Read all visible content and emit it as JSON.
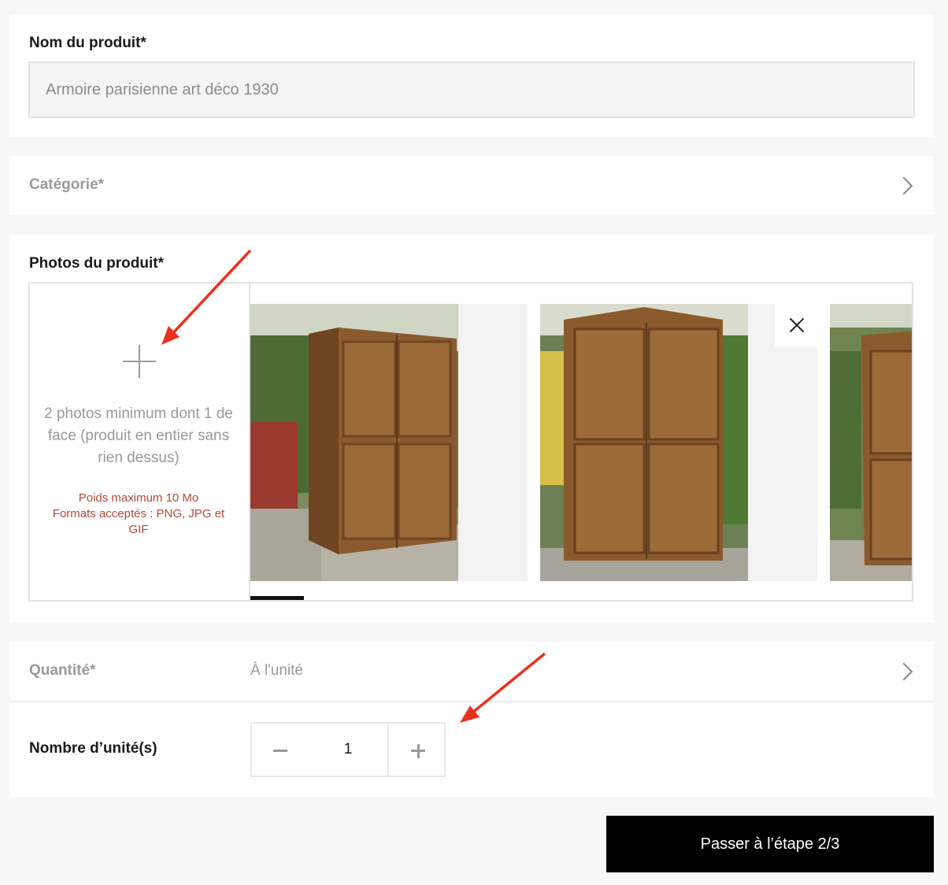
{
  "product_name": {
    "label": "Nom du produit*",
    "placeholder": "Armoire parisienne art déco 1930"
  },
  "category": {
    "label": "Catégorie*",
    "chevron_icon": "chevron-right-icon"
  },
  "photos": {
    "label": "Photos du produit*",
    "upload_icon": "plus-icon",
    "hint": "2 photos minimum dont 1 de face (produit en entier sans rien dessus)",
    "limits_line1": "Poids maximum 10 Mo",
    "limits_line2": "Formats acceptés : PNG, JPG et GIF",
    "remove_icon": "close-icon",
    "items": [
      {
        "subject": "wooden armoire, side angle view"
      },
      {
        "subject": "wooden armoire, front view"
      },
      {
        "subject": "wooden armoire, partially visible"
      }
    ]
  },
  "quantity": {
    "label": "Quantité*",
    "value": "À l'unité",
    "chevron_icon": "chevron-right-icon"
  },
  "units": {
    "label": "Nombre d’unité(s)",
    "value": "1",
    "decrement_icon": "minus-icon",
    "increment_icon": "plus-icon"
  },
  "next_button": {
    "label": "Passer à l’étape 2/3"
  },
  "colors": {
    "primary_button": "#000000",
    "warning_text": "#b34a3a",
    "annotation_arrow": "#e8321e"
  }
}
